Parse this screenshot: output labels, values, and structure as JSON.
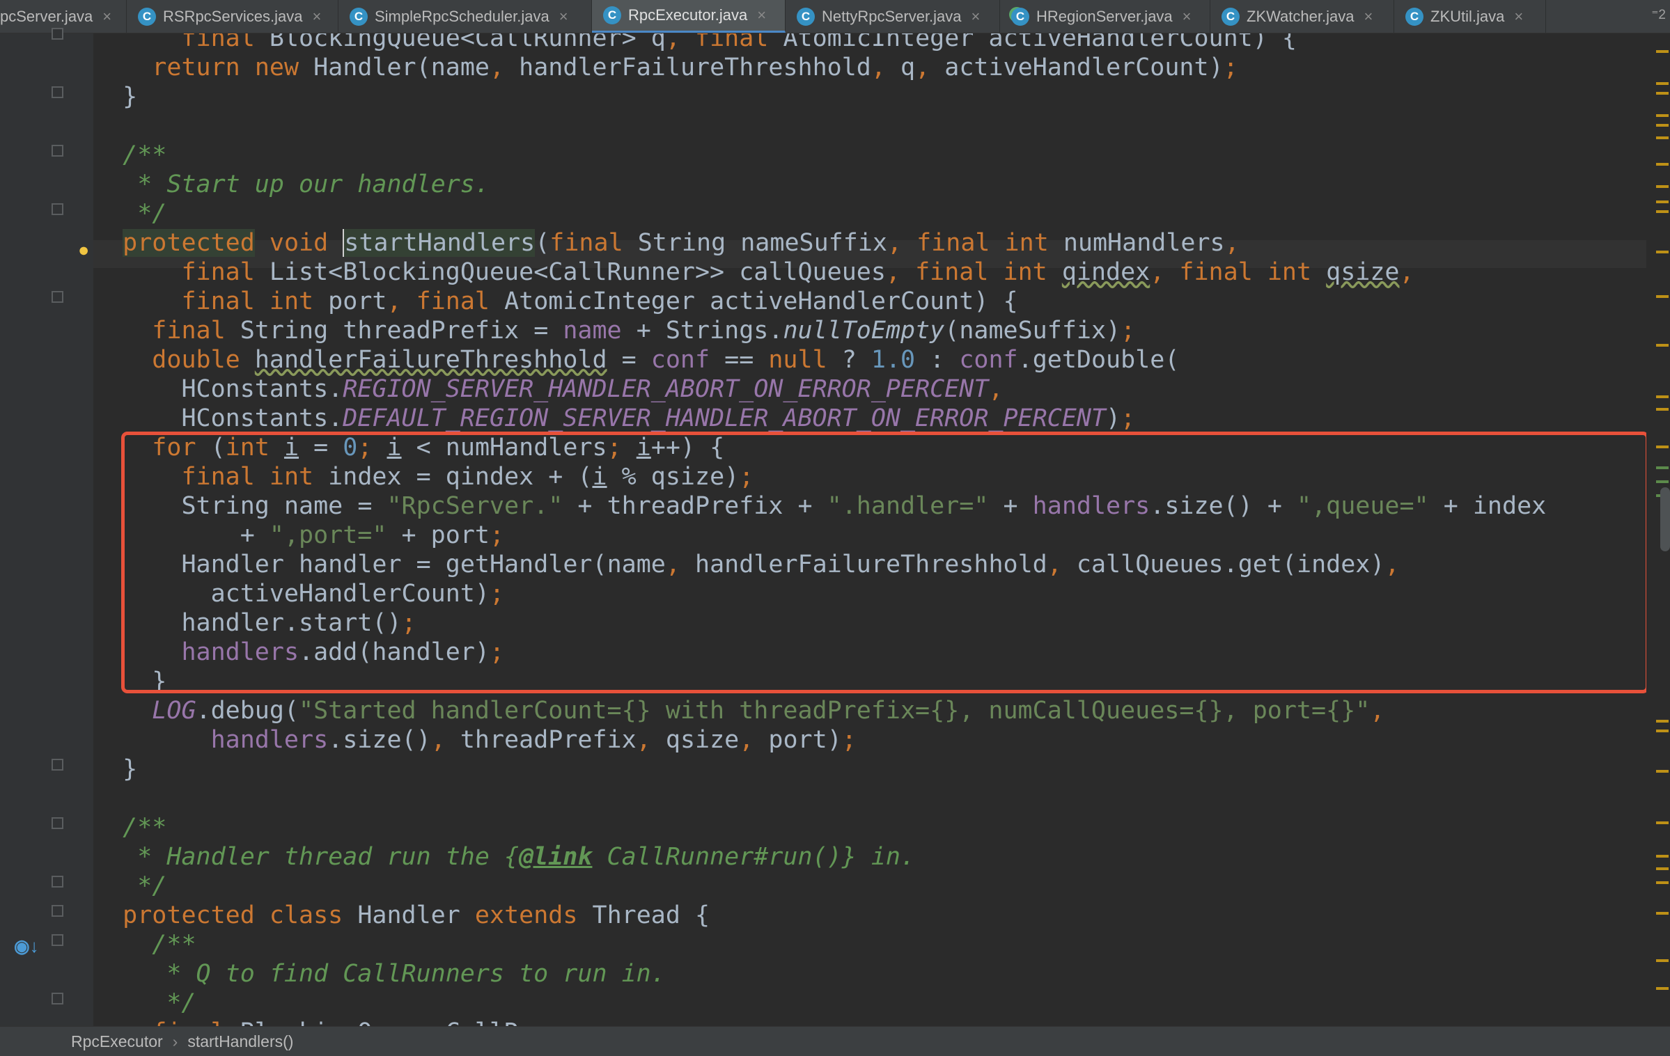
{
  "tabs": [
    {
      "label": "pcServer.java",
      "icon": "none",
      "active": false
    },
    {
      "label": "RSRpcServices.java",
      "icon": "class",
      "active": false
    },
    {
      "label": "SimpleRpcScheduler.java",
      "icon": "class",
      "active": false
    },
    {
      "label": "RpcExecutor.java",
      "icon": "class",
      "active": true
    },
    {
      "label": "NettyRpcServer.java",
      "icon": "class",
      "active": false
    },
    {
      "label": "HRegionServer.java",
      "icon": "runnable-class",
      "active": false
    },
    {
      "label": "ZKWatcher.java",
      "icon": "class",
      "active": false
    },
    {
      "label": "ZKUtil.java",
      "icon": "class",
      "active": false
    }
  ],
  "tab_close_glyph": "×",
  "tab_icon_letter": "C",
  "tab_menu_label": "⁼2",
  "breadcrumb": {
    "class_name": "RpcExecutor",
    "separator": "›",
    "method_name": "startHandlers()"
  },
  "highlight_color": "#e8513a",
  "code": {
    "handlers": "handlers",
    "threadPrefix": "threadPrefix",
    "qsize": "qsize",
    "port": "port",
    "index": "index",
    "name": "name",
    "q": "q",
    "activeHandlerCount": "activeHandlerCount",
    "handlerFailureThreshhold": "handlerFailureThreshhold",
    "nameSuffix": "nameSuffix",
    "numHandlers": "numHandlers",
    "callQueues": "callQueues",
    "qindex": "qindex",
    "conf": "conf",
    "i": "i",
    "handler": "handler",
    "Handler": "Handler",
    "CallRunner": "CallRunner",
    "BlockingQueue": "BlockingQueue",
    "AtomicInteger": "AtomicInteger",
    "String": "String",
    "List": "List",
    "HConstants": "HConstants",
    "Strings": "Strings",
    "Thread": "Thread",
    "LOG": "LOG",
    "REGION_SERVER_HANDLER_ABORT_ON_ERROR_PERCENT": "REGION_SERVER_HANDLER_ABORT_ON_ERROR_PERCENT",
    "DEFAULT_REGION_SERVER_HANDLER_ABORT_ON_ERROR_PERCENT": "DEFAULT_REGION_SERVER_HANDLER_ABORT_ON_ERROR_PERCENT",
    "nullToEmpty": "nullToEmpty",
    "getDouble": "getDouble",
    "getHandler": "getHandler",
    "size": "size",
    "get": "get",
    "start": "start",
    "add": "add",
    "debug": "debug",
    "run": "run",
    "startHandlers": "startHandlers",
    "kw_final": "final",
    "kw_return": "return",
    "kw_new": "new",
    "kw_protected": "protected",
    "kw_void": "void",
    "kw_int": "int",
    "kw_double": "double",
    "kw_null": "null",
    "kw_for": "for",
    "kw_class": "class",
    "kw_extends": "extends",
    "num_1_0": "1.0",
    "num_0": "0",
    "str_rpcserver": "\"RpcServer.\"",
    "str_handler": "\".handler=\"",
    "str_queue": "\",queue=\"",
    "str_port": "\",port=\"",
    "str_log": "\"Started handlerCount={} with threadPrefix={}, numCallQueues={}, port={}\"",
    "doc_open": "/**",
    "doc_close": "*/",
    "doc_startup": "* Start up our handlers.",
    "doc_handler_a": "* Handler thread run the {",
    "doc_link": "@link",
    "doc_handler_b": " CallRunner#run()} in.",
    "doc_q": "* Q to find CallRunners to run in."
  }
}
